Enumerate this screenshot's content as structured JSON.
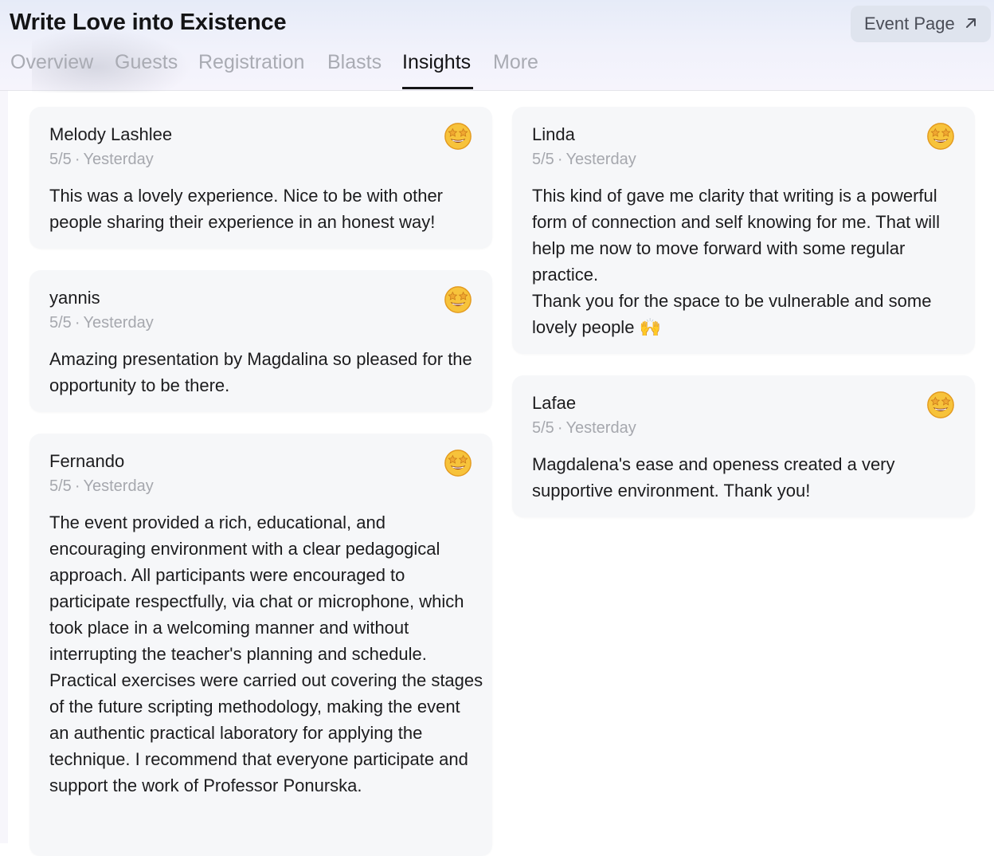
{
  "header": {
    "title": "Write Love into Existence",
    "event_button_label": "Event Page",
    "tabs": [
      {
        "label": "Overview",
        "active": false
      },
      {
        "label": "Guests",
        "active": false
      },
      {
        "label": "Registration",
        "active": false
      },
      {
        "label": "Blasts",
        "active": false
      },
      {
        "label": "Insights",
        "active": true
      },
      {
        "label": "More",
        "active": false
      }
    ]
  },
  "feedback": [
    {
      "name": "Melody Lashlee",
      "rating": "5/5",
      "separator": "·",
      "date": "Yesterday",
      "reaction_icon": "star-struck-emoji",
      "text": "This was a lovely experience. Nice to be with other people sharing their experience in an honest way!"
    },
    {
      "name": "yannis",
      "rating": "5/5",
      "separator": "·",
      "date": "Yesterday",
      "reaction_icon": "star-struck-emoji",
      "text": "Amazing presentation by Magdalina so pleased for the opportunity to be there."
    },
    {
      "name": "Fernando",
      "rating": "5/5",
      "separator": "·",
      "date": "Yesterday",
      "reaction_icon": "star-struck-emoji",
      "text": "The event provided a rich, educational, and encouraging environment with a clear pedagogical approach. All participants were encouraged to participate respectfully, via chat or microphone, which took place in a welcoming manner and without interrupting the teacher's planning and schedule. Practical exercises were carried out covering the stages of the future scripting methodology, making the event an authentic practical laboratory for applying the technique. I recommend that everyone participate and support the work of Professor Ponurska."
    },
    {
      "name": "Linda",
      "rating": "5/5",
      "separator": "·",
      "date": "Yesterday",
      "reaction_icon": "star-struck-emoji",
      "text": "This kind of gave me clarity that writing is a powerful form of connection and self knowing for me. That will help me now to move forward with some regular practice.\nThank you for the space to be vulnerable and some lovely people 🙌"
    },
    {
      "name": "Lafae",
      "rating": "5/5",
      "separator": "·",
      "date": "Yesterday",
      "reaction_icon": "star-struck-emoji",
      "text": "Magdalena's ease and openess created a very supportive environment. Thank you!"
    }
  ],
  "colors": {
    "emoji_face": "#f7c33b",
    "emoji_face_dark": "#e39a1f",
    "emoji_star": "#f0a830",
    "emoji_mouth": "#8a3b1a"
  }
}
